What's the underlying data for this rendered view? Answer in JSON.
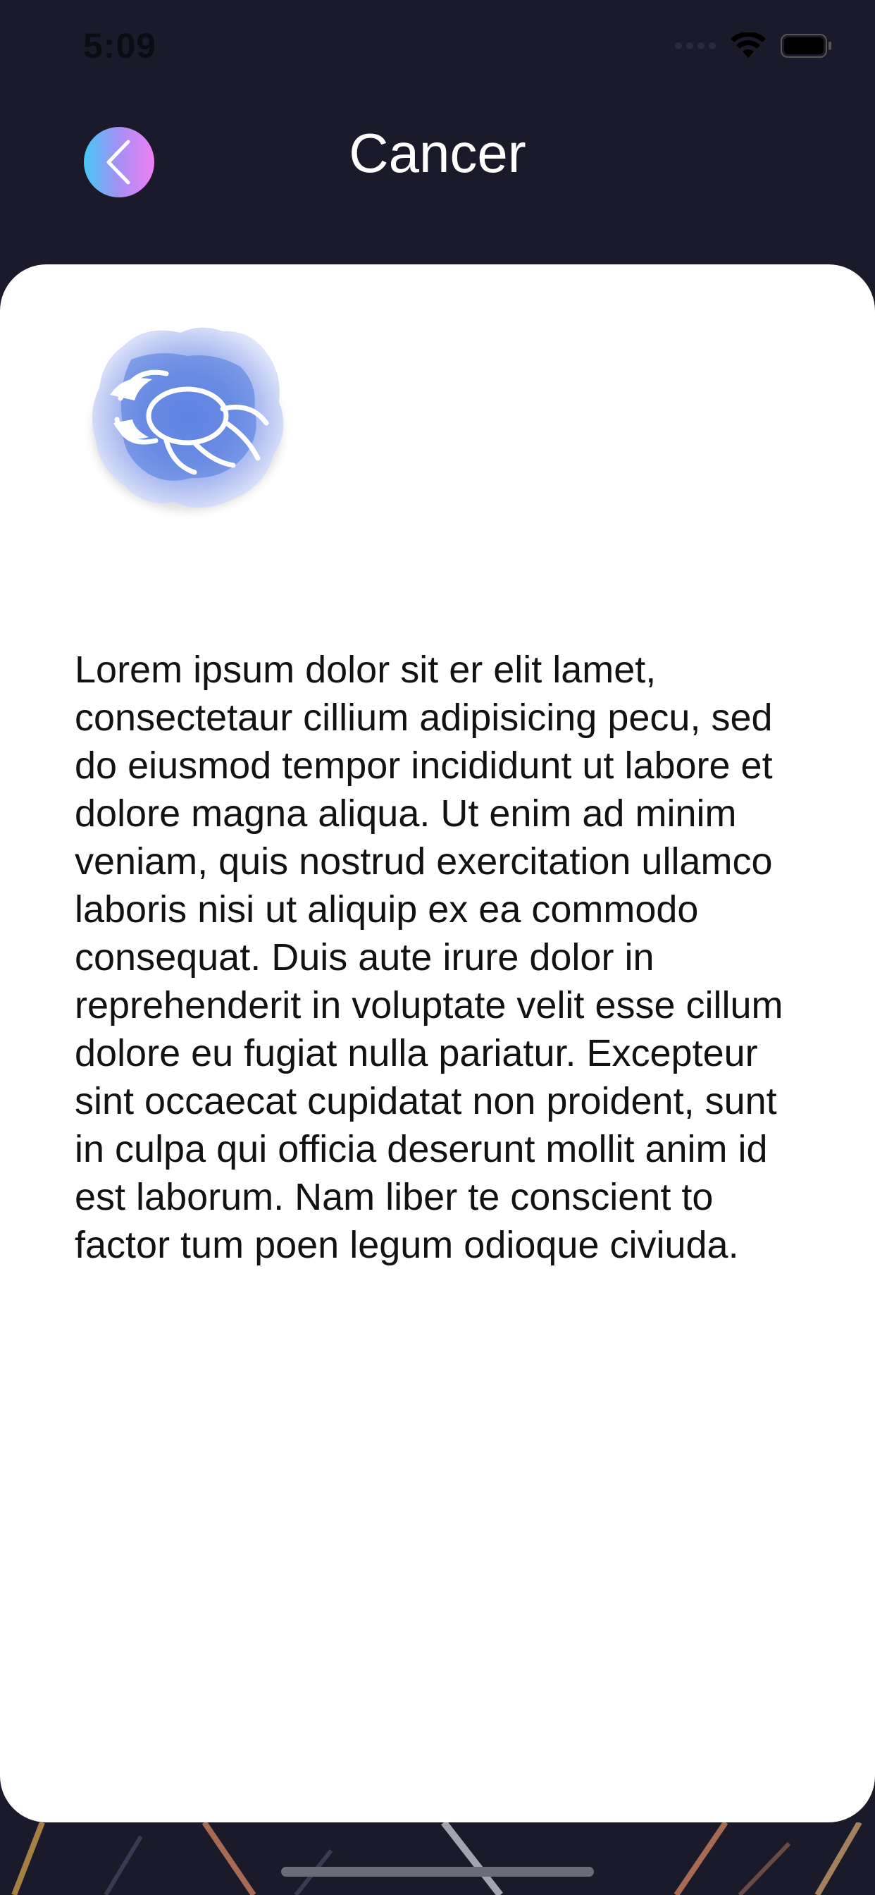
{
  "status_bar": {
    "time": "5:09"
  },
  "header": {
    "title": "Cancer",
    "back_icon": "chevron-left-icon"
  },
  "content": {
    "image_icon": "cancer-zodiac-crab-image",
    "description": "Lorem ipsum dolor sit er elit lamet, consectetaur cillium adipisicing pecu, sed do eiusmod tempor incididunt ut labore et dolore magna aliqua. Ut enim ad minim veniam, quis nostrud exercitation ullamco laboris nisi ut aliquip ex ea commodo consequat. Duis aute irure dolor in reprehenderit in voluptate velit esse cillum dolore eu fugiat nulla pariatur. Excepteur sint occaecat cupidatat non proident, sunt in culpa qui officia deserunt mollit anim id est laborum. Nam liber te conscient to factor tum poen legum odioque civiuda."
  },
  "colors": {
    "background": "#1b1a2b",
    "card": "#ffffff",
    "title": "#ffffff",
    "text": "#121212",
    "back_gradient_start": "#45c7f5",
    "back_gradient_end": "#ee7ff5"
  }
}
